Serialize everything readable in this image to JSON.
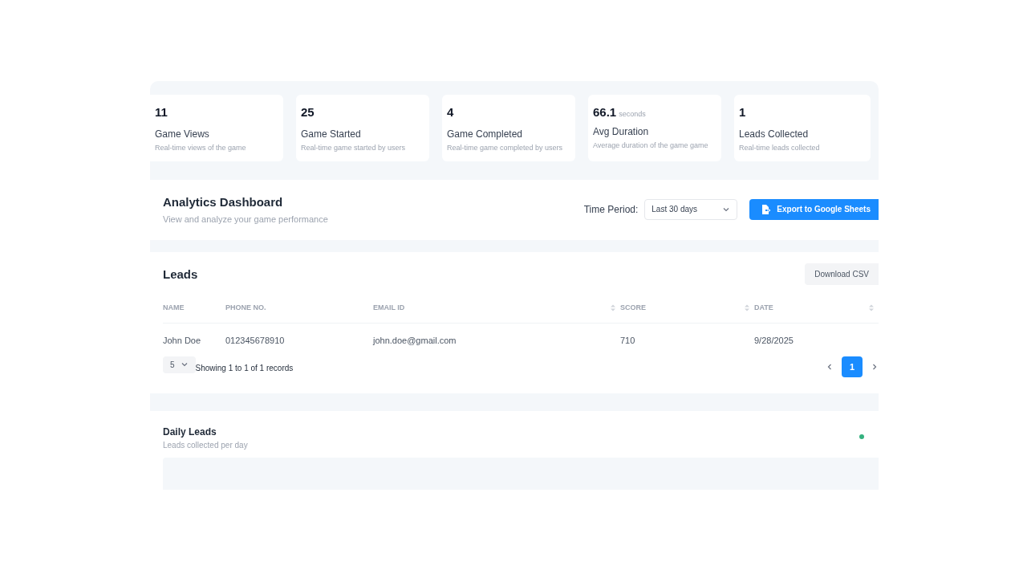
{
  "stats": [
    {
      "value": "11",
      "title": "Game Views",
      "description": "Real-time views of the game"
    },
    {
      "value": "25",
      "title": "Game Started",
      "description": "Real-time game started by users"
    },
    {
      "value": "4",
      "title": "Game Completed",
      "description": "Real-time game completed by users"
    },
    {
      "value": "66.1",
      "unit": "seconds",
      "title": "Avg Duration",
      "description": "Average duration of the game game"
    },
    {
      "value": "1",
      "title": "Leads Collected",
      "description": "Real-time leads collected"
    }
  ],
  "header": {
    "title": "Analytics Dashboard",
    "subtitle": "View and analyze your game performance",
    "period_label": "Time Period:",
    "period_value": "Last 30 days",
    "export_button": "Export to Google Sheets"
  },
  "leads": {
    "title": "Leads",
    "download_button": "Download CSV",
    "columns": [
      {
        "label": "NAME",
        "sortable": false
      },
      {
        "label": "PHONE NO.",
        "sortable": false
      },
      {
        "label": "EMAIL ID",
        "sortable": true
      },
      {
        "label": "SCORE",
        "sortable": true
      },
      {
        "label": "DATE",
        "sortable": true
      }
    ],
    "rows": [
      [
        "John Doe",
        "012345678910",
        "john.doe@gmail.com",
        "710",
        "9/28/2025"
      ]
    ],
    "page_size": "5",
    "summary": "Showing 1 to 1 of 1 records",
    "pages": [
      {
        "label": "1",
        "selected": true
      }
    ]
  },
  "daily_leads": {
    "title": "Daily Leads",
    "subtitle": "Leads collected per day"
  }
}
